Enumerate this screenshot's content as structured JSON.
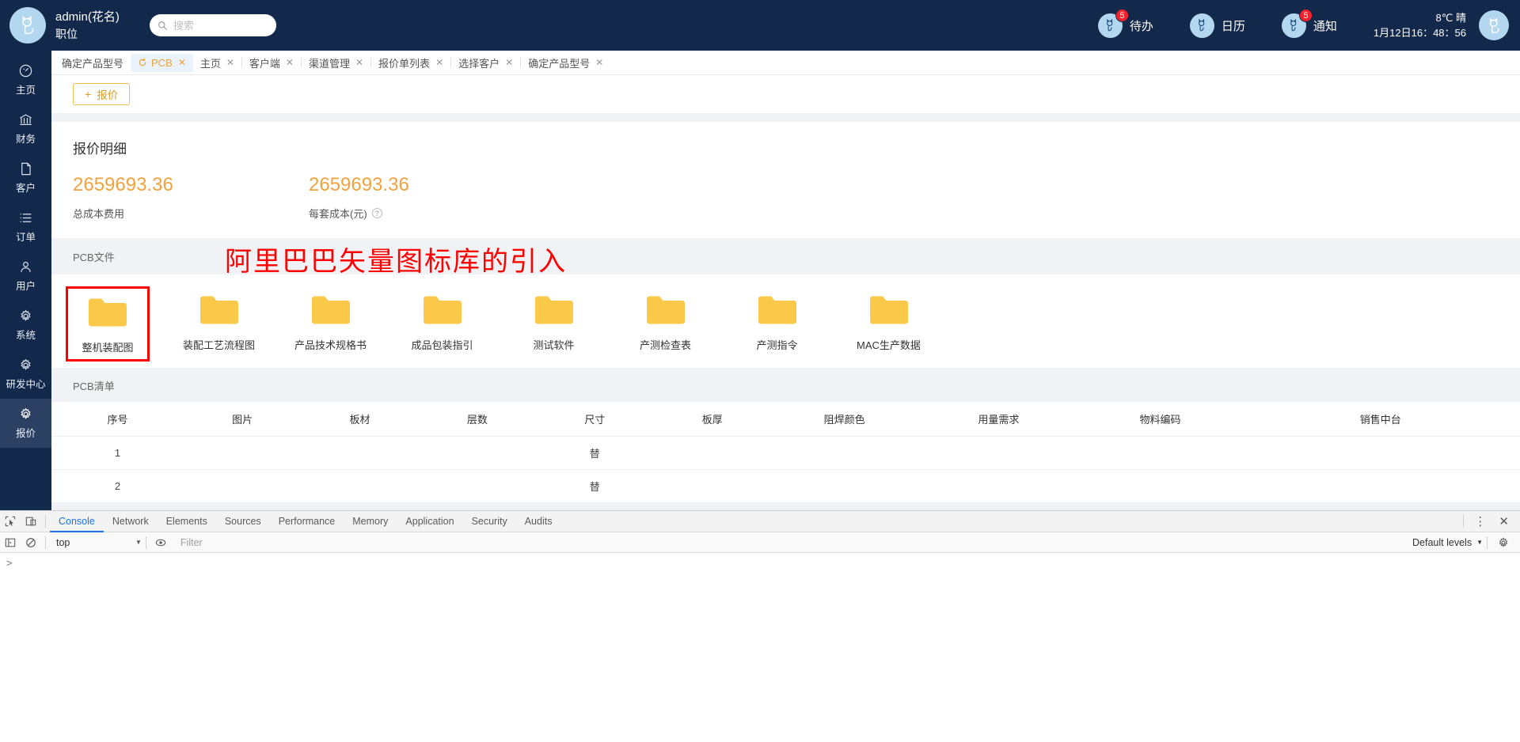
{
  "header": {
    "user_name": "admin(花名)",
    "user_role": "职位",
    "search_placeholder": "搜索",
    "items": [
      {
        "label": "待办",
        "badge": "5",
        "icon": "todo-icon"
      },
      {
        "label": "日历",
        "badge": "",
        "icon": "calendar-icon"
      },
      {
        "label": "通知",
        "badge": "5",
        "icon": "notification-icon"
      }
    ],
    "weather": "8℃ 晴",
    "datetime": "1月12日16：48：56"
  },
  "sidebar": {
    "items": [
      {
        "label": "主页",
        "icon": "dashboard-icon",
        "active": false
      },
      {
        "label": "财务",
        "icon": "bank-icon",
        "active": false
      },
      {
        "label": "客户",
        "icon": "document-icon",
        "active": false
      },
      {
        "label": "订单",
        "icon": "list-icon",
        "active": false
      },
      {
        "label": "用户",
        "icon": "user-icon",
        "active": false
      },
      {
        "label": "系统",
        "icon": "gear-icon",
        "active": false
      },
      {
        "label": "研发中心",
        "icon": "gear-icon",
        "active": false
      },
      {
        "label": "报价",
        "icon": "gear-icon",
        "active": true
      }
    ]
  },
  "tabs": [
    {
      "label": "确定产品型号",
      "active": false,
      "closable": false
    },
    {
      "label": "PCB",
      "active": true,
      "closable": true
    },
    {
      "label": "主页",
      "active": false,
      "closable": true
    },
    {
      "label": "客户端",
      "active": false,
      "closable": true
    },
    {
      "label": "渠道管理",
      "active": false,
      "closable": true
    },
    {
      "label": "报价单列表",
      "active": false,
      "closable": true
    },
    {
      "label": "选择客户",
      "active": false,
      "closable": true
    },
    {
      "label": "确定产品型号",
      "active": false,
      "closable": true
    }
  ],
  "toolbar": {
    "quote_button": "报价",
    "plus": "+"
  },
  "quote_detail": {
    "title": "报价明细",
    "metrics": [
      {
        "value": "2659693.36",
        "label": "总成本费用",
        "help": false
      },
      {
        "value": "2659693.36",
        "label": "每套成本(元)",
        "help": true
      }
    ]
  },
  "pcb_files": {
    "section_label": "PCB文件",
    "annotation": "阿里巴巴矢量图标库的引入",
    "folders": [
      {
        "name": "整机装配图",
        "highlighted": true
      },
      {
        "name": "装配工艺流程图",
        "highlighted": false
      },
      {
        "name": "产品技术规格书",
        "highlighted": false
      },
      {
        "name": "成品包装指引",
        "highlighted": false
      },
      {
        "name": "测试软件",
        "highlighted": false
      },
      {
        "name": "产测检查表",
        "highlighted": false
      },
      {
        "name": "产测指令",
        "highlighted": false
      },
      {
        "name": "MAC生产数据",
        "highlighted": false
      }
    ]
  },
  "pcb_list": {
    "section_label": "PCB清单",
    "columns": [
      "序号",
      "图片",
      "板材",
      "层数",
      "尺寸",
      "板厚",
      "阻焊颜色",
      "用量需求",
      "物料编码",
      "销售中台"
    ],
    "rows": [
      {
        "序号": "1",
        "图片": "",
        "板材": "",
        "层数": "",
        "尺寸": "替",
        "板厚": "",
        "阻焊颜色": "",
        "用量需求": "",
        "物料编码": "",
        "销售中台": ""
      },
      {
        "序号": "2",
        "图片": "",
        "板材": "",
        "层数": "",
        "尺寸": "替",
        "板厚": "",
        "阻焊颜色": "",
        "用量需求": "",
        "物料编码": "",
        "销售中台": ""
      }
    ]
  },
  "devtools": {
    "tabs": [
      "Console",
      "Network",
      "Elements",
      "Sources",
      "Performance",
      "Memory",
      "Application",
      "Security",
      "Audits"
    ],
    "active_tab": "Console",
    "context_selector": "top",
    "filter_placeholder": "Filter",
    "levels_label": "Default levels",
    "prompt": ">"
  },
  "colors": {
    "header_bg": "#13294b",
    "accent_orange": "#f2a23c",
    "annotation_red": "#fe0000",
    "folder_yellow": "#fbc94a",
    "devtools_blue": "#1a73e8"
  }
}
